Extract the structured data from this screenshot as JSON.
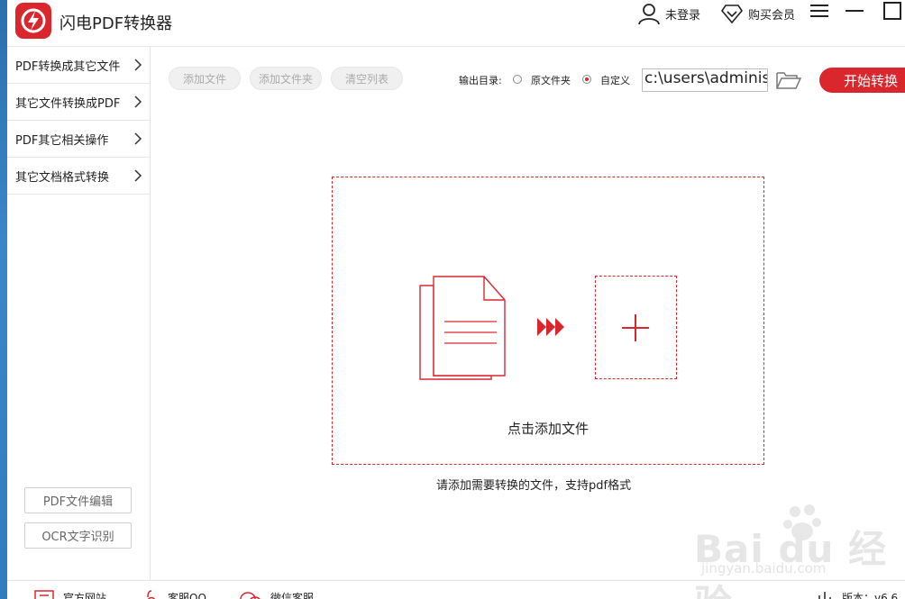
{
  "app": {
    "title": "闪电PDF转换器",
    "accent_color": "#d9272d"
  },
  "header": {
    "login_label": "未登录",
    "vip_label": "购买会员",
    "icons": [
      "user-icon",
      "diamond-icon",
      "menu-icon",
      "minimize-icon",
      "maximize-icon"
    ]
  },
  "sidebar": {
    "items": [
      {
        "label": "PDF转换成其它文件"
      },
      {
        "label": "其它文件转换成PDF"
      },
      {
        "label": "PDF其它相关操作"
      },
      {
        "label": "其它文档格式转换"
      }
    ],
    "bottom_buttons": [
      {
        "label": "PDF文件编辑"
      },
      {
        "label": "OCR文字识别"
      }
    ]
  },
  "toolbar": {
    "add_file_label": "添加文件",
    "add_folder_label": "添加文件夹",
    "clear_list_label": "清空列表",
    "output_dir_label": "输出目录:",
    "radio_original_label": "原文件夹",
    "radio_custom_label": "自定义",
    "selected_output": "自定义",
    "output_path": "c:\\users\\administ",
    "start_label": "开始转换"
  },
  "dropzone": {
    "click_text": "点击添加文件",
    "hint_text": "请添加需要转换的文件，支持pdf格式"
  },
  "statusbar": {
    "items": [
      {
        "label": "官方网站"
      },
      {
        "label": "客服QQ"
      },
      {
        "label": "微信客服"
      },
      {
        "label": "版本：v6.6"
      }
    ]
  },
  "watermark": {
    "brand": "Bai du 经验",
    "url": "jingyan.baidu.com"
  }
}
